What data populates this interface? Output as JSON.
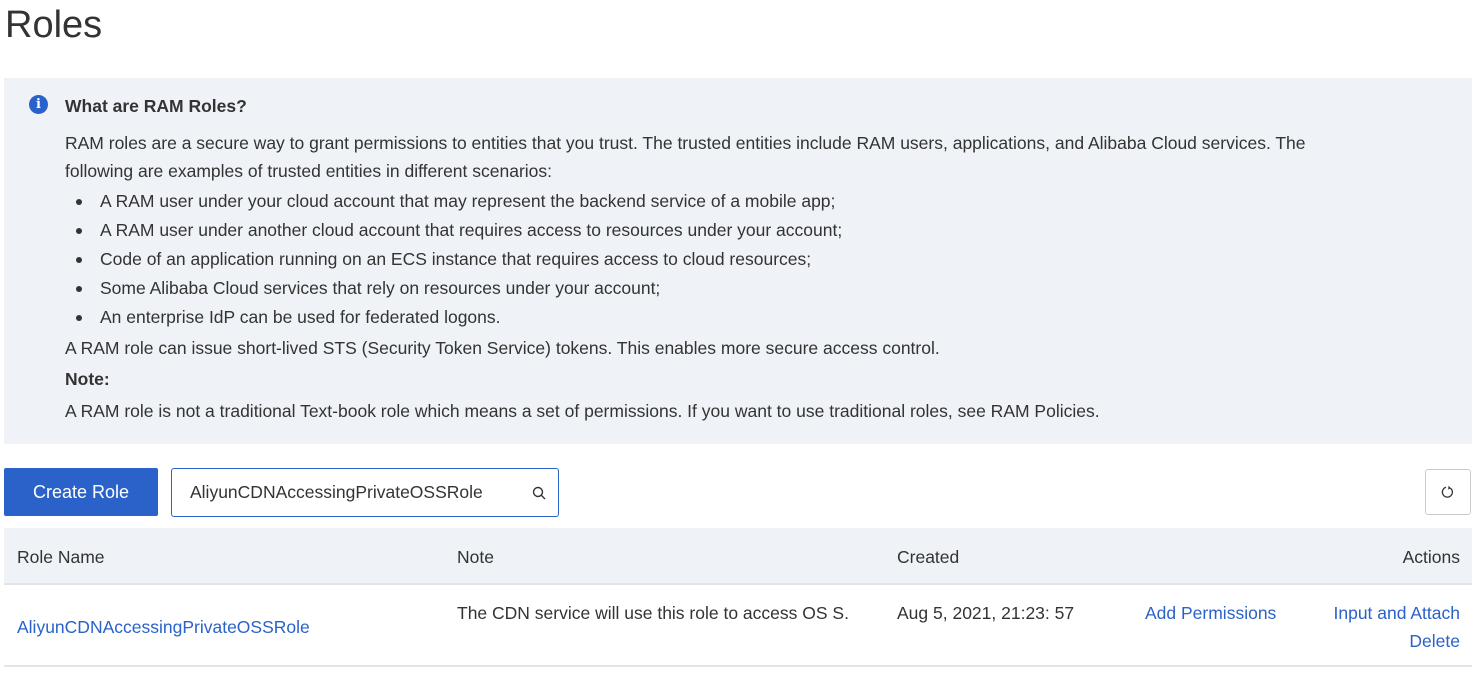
{
  "page": {
    "title": "Roles"
  },
  "info": {
    "heading": "What are RAM Roles?",
    "intro": "RAM roles are a secure way to grant permissions to entities that you trust. The trusted entities include RAM users, applications, and Alibaba Cloud services. The following are examples of trusted entities in different scenarios:",
    "bullets": [
      "A RAM user under your cloud account that may represent the backend service of a mobile app;",
      "A RAM user under another cloud account that requires access to resources under your account;",
      "Code of an application running on an ECS instance that requires access to cloud resources;",
      "Some Alibaba Cloud services that rely on resources under your account;",
      "An enterprise IdP can be used for federated logons."
    ],
    "sts": "A RAM role can issue short-lived STS (Security Token Service) tokens. This enables more secure access control.",
    "note_label": "Note:",
    "note": "A RAM role is not a traditional Text-book role which means a set of permissions. If you want to use traditional roles, see RAM Policies."
  },
  "toolbar": {
    "create_label": "Create Role",
    "search_value": "AliyunCDNAccessingPrivateOSSRole",
    "refresh_icon": "refresh-icon"
  },
  "table": {
    "headers": [
      "Role Name",
      "Note",
      "Created",
      "Actions"
    ],
    "rows": [
      {
        "name": "AliyunCDNAccessingPrivateOSSRole",
        "note": "The CDN service will use this role to access OS S.",
        "created": "Aug 5, 2021, 21:23: 57",
        "actions": [
          "Add Permissions",
          "Input and Attach",
          "Delete"
        ]
      }
    ]
  },
  "colors": {
    "accent": "#2a62c9",
    "panel_bg": "#eff2f7"
  }
}
